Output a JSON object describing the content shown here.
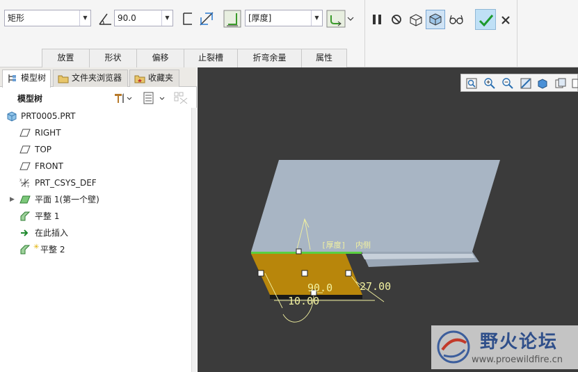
{
  "dashboard": {
    "shape_select": "矩形",
    "angle_value": "90.0",
    "thickness_select": "[厚度]",
    "tabs": [
      "放置",
      "形状",
      "偏移",
      "止裂槽",
      "折弯余量",
      "属性"
    ]
  },
  "navigator": {
    "tabs": [
      "模型树",
      "文件夹浏览器",
      "收藏夹"
    ],
    "tree_title": "模型树",
    "items": [
      {
        "label": "PRT0005.PRT"
      },
      {
        "label": "RIGHT"
      },
      {
        "label": "TOP"
      },
      {
        "label": "FRONT"
      },
      {
        "label": "PRT_CSYS_DEF"
      },
      {
        "label": "平面 1(第一个壁)"
      },
      {
        "label": "平整 1"
      },
      {
        "label": "在此插入"
      },
      {
        "label": "平整 2"
      }
    ]
  },
  "viewport": {
    "annotations": {
      "thickness_tag": "[厚度]",
      "side_tag": "内侧",
      "angle_dim": "90.0",
      "length_dim": "10.00",
      "offset_dim": "27.00"
    }
  },
  "watermark": {
    "title": "野火论坛",
    "url": "www.proewildfire.cn"
  }
}
